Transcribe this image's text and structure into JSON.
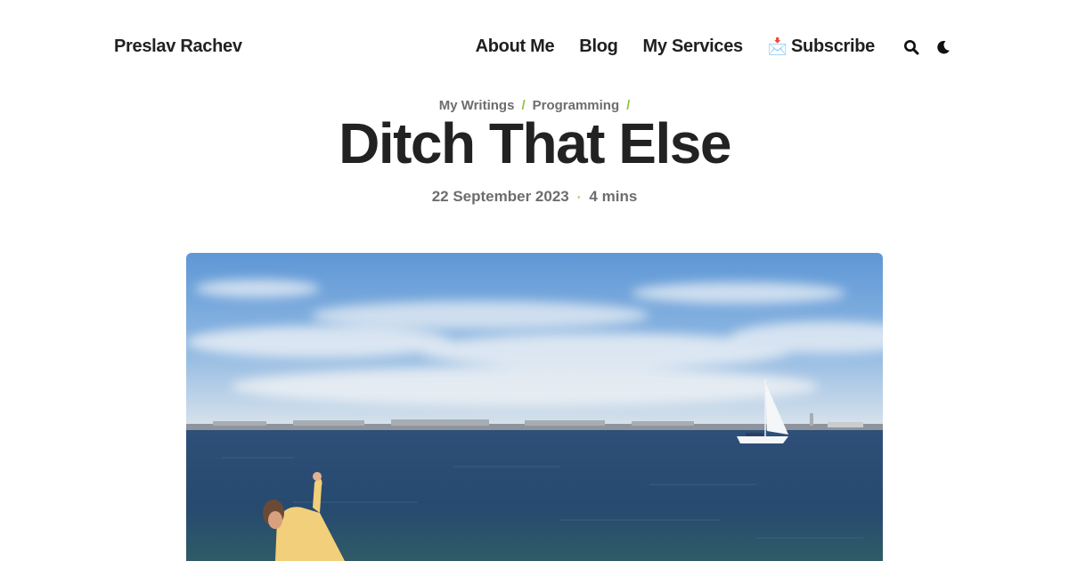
{
  "site": {
    "title": "Preslav Rachev"
  },
  "nav": {
    "items": [
      {
        "label": "About Me"
      },
      {
        "label": "Blog"
      },
      {
        "label": "My Services"
      },
      {
        "label": "Subscribe",
        "emoji": "📩"
      }
    ],
    "search_icon": "search-icon",
    "theme_icon": "moon-icon"
  },
  "breadcrumb": {
    "items": [
      "My Writings",
      "Programming"
    ],
    "separator": "/"
  },
  "post": {
    "title": "Ditch That Else",
    "date": "22 September 2023",
    "reading_time": "4 mins",
    "meta_separator": "·"
  },
  "hero_image": {
    "description_icon": "sea-photo"
  },
  "colors": {
    "accent": "#8cc63f",
    "text": "#222222",
    "muted": "#6d6d6d"
  }
}
